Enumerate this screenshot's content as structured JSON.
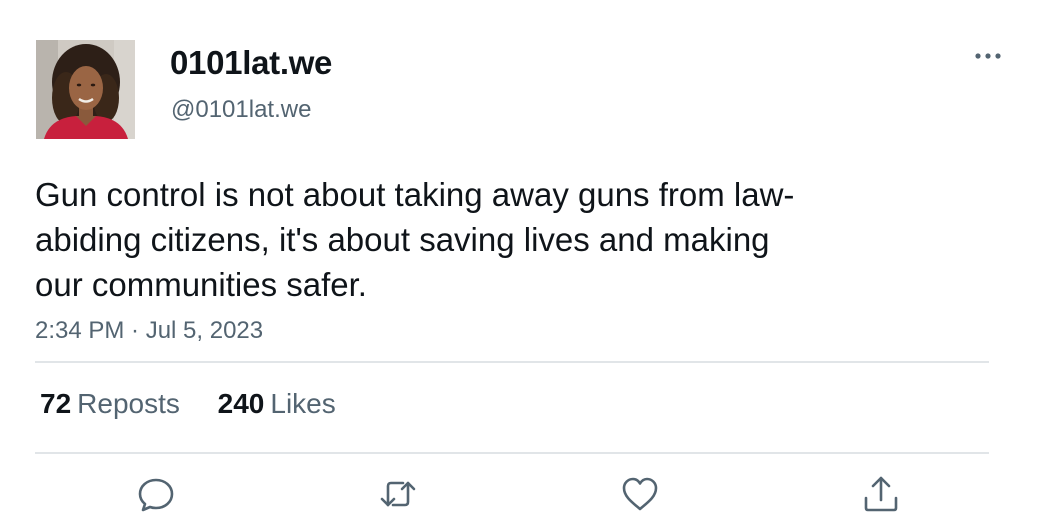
{
  "user": {
    "display_name": "0101lat.we",
    "handle": "@0101lat.we",
    "avatar_icon": "profile-photo"
  },
  "tweet": {
    "text_lines": [
      "Gun control is not about taking away guns from law-",
      "abiding citizens, it's about saving lives and making",
      "our communities safer."
    ],
    "timestamp": "2:34 PM · Jul 5, 2023"
  },
  "stats": {
    "reposts_count": "72",
    "reposts_label": "Reposts",
    "likes_count": "240",
    "likes_label": "Likes"
  },
  "actions": {
    "reply_icon": "speech-bubble-icon",
    "repost_icon": "retweet-arrows-icon",
    "like_icon": "heart-icon",
    "share_icon": "share-upload-icon",
    "more_icon": "ellipsis-icon"
  },
  "colors": {
    "text_primary": "#0f1419",
    "text_secondary": "#536471",
    "divider": "#e1e5e8",
    "icon": "#536471"
  }
}
